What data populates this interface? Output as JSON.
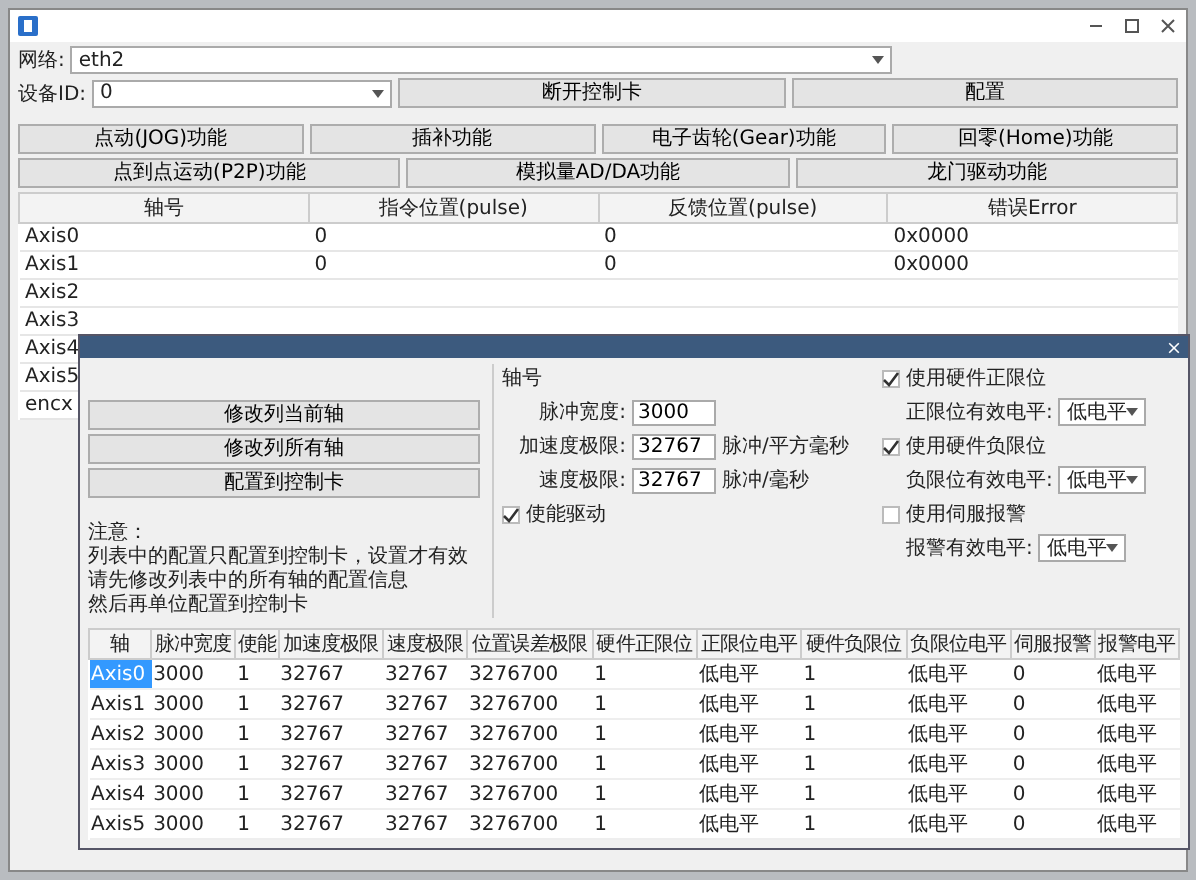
{
  "network": {
    "label": "网络:",
    "value": "eth2"
  },
  "device": {
    "label": "设备ID:",
    "value": "0"
  },
  "device_buttons": [
    "断开控制卡",
    "配置"
  ],
  "function_rows": [
    [
      "点动(JOG)功能",
      "插补功能",
      "电子齿轮(Gear)功能",
      "回零(Home)功能"
    ],
    [
      "点到点运动(P2P)功能",
      "模拟量AD/DA功能",
      "龙门驱动功能"
    ]
  ],
  "status_table": {
    "columns": [
      "轴号",
      "指令位置(pulse)",
      "反馈位置(pulse)",
      "错误Error"
    ],
    "rows": [
      [
        "Axis0",
        "0",
        "0",
        "0x0000"
      ],
      [
        "Axis1",
        "0",
        "0",
        "0x0000"
      ],
      [
        "Axis2"
      ],
      [
        "Axis3"
      ],
      [
        "Axis4"
      ],
      [
        "Axis5"
      ],
      [
        "encx"
      ]
    ]
  },
  "dialog": {
    "buttons": [
      "修改列当前轴",
      "修改列所有轴",
      "配置到控制卡"
    ],
    "note_title": "注意：",
    "note_lines": [
      "列表中的配置只配置到控制卡，设置才有效",
      "请先修改列表中的所有轴的配置信息",
      "然后再单位配置到控制卡"
    ],
    "axis_label": "轴号",
    "fields": [
      {
        "label": "脉冲宽度:",
        "value": "3000"
      },
      {
        "label": "加速度极限:",
        "value": "32767",
        "unit": "脉冲/平方毫秒"
      },
      {
        "label": "速度极限:",
        "value": "32767",
        "unit": "脉冲/毫秒"
      }
    ],
    "enable": {
      "label": "使能驱动",
      "checked": true
    },
    "options": [
      {
        "kind": "check",
        "label": "使用硬件正限位",
        "checked": true
      },
      {
        "kind": "select",
        "label": "正限位有效电平:",
        "value": "低电平"
      },
      {
        "kind": "check",
        "label": "使用硬件负限位",
        "checked": true
      },
      {
        "kind": "select",
        "label": "负限位有效电平:",
        "value": "低电平"
      },
      {
        "kind": "check",
        "label": "使用伺服报警",
        "checked": false
      },
      {
        "kind": "select",
        "label": "报警有效电平:",
        "value": "低电平"
      }
    ],
    "table": {
      "columns": [
        "轴",
        "脉冲宽度",
        "使能",
        "加速度极限",
        "速度极限",
        "位置误差极限",
        "硬件正限位",
        "正限位电平",
        "硬件负限位",
        "负限位电平",
        "伺服报警",
        "报警电平"
      ],
      "rows": [
        {
          "selected": true,
          "cells": [
            "Axis0",
            "3000",
            "1",
            "32767",
            "32767",
            "3276700",
            "1",
            "低电平",
            "1",
            "低电平",
            "0",
            "低电平"
          ]
        },
        {
          "selected": false,
          "cells": [
            "Axis1",
            "3000",
            "1",
            "32767",
            "32767",
            "3276700",
            "1",
            "低电平",
            "1",
            "低电平",
            "0",
            "低电平"
          ]
        },
        {
          "selected": false,
          "cells": [
            "Axis2",
            "3000",
            "1",
            "32767",
            "32767",
            "3276700",
            "1",
            "低电平",
            "1",
            "低电平",
            "0",
            "低电平"
          ]
        },
        {
          "selected": false,
          "cells": [
            "Axis3",
            "3000",
            "1",
            "32767",
            "32767",
            "3276700",
            "1",
            "低电平",
            "1",
            "低电平",
            "0",
            "低电平"
          ]
        },
        {
          "selected": false,
          "cells": [
            "Axis4",
            "3000",
            "1",
            "32767",
            "32767",
            "3276700",
            "1",
            "低电平",
            "1",
            "低电平",
            "0",
            "低电平"
          ]
        },
        {
          "selected": false,
          "cells": [
            "Axis5",
            "3000",
            "1",
            "32767",
            "32767",
            "3276700",
            "1",
            "低电平",
            "1",
            "低电平",
            "0",
            "低电平"
          ]
        }
      ]
    }
  }
}
